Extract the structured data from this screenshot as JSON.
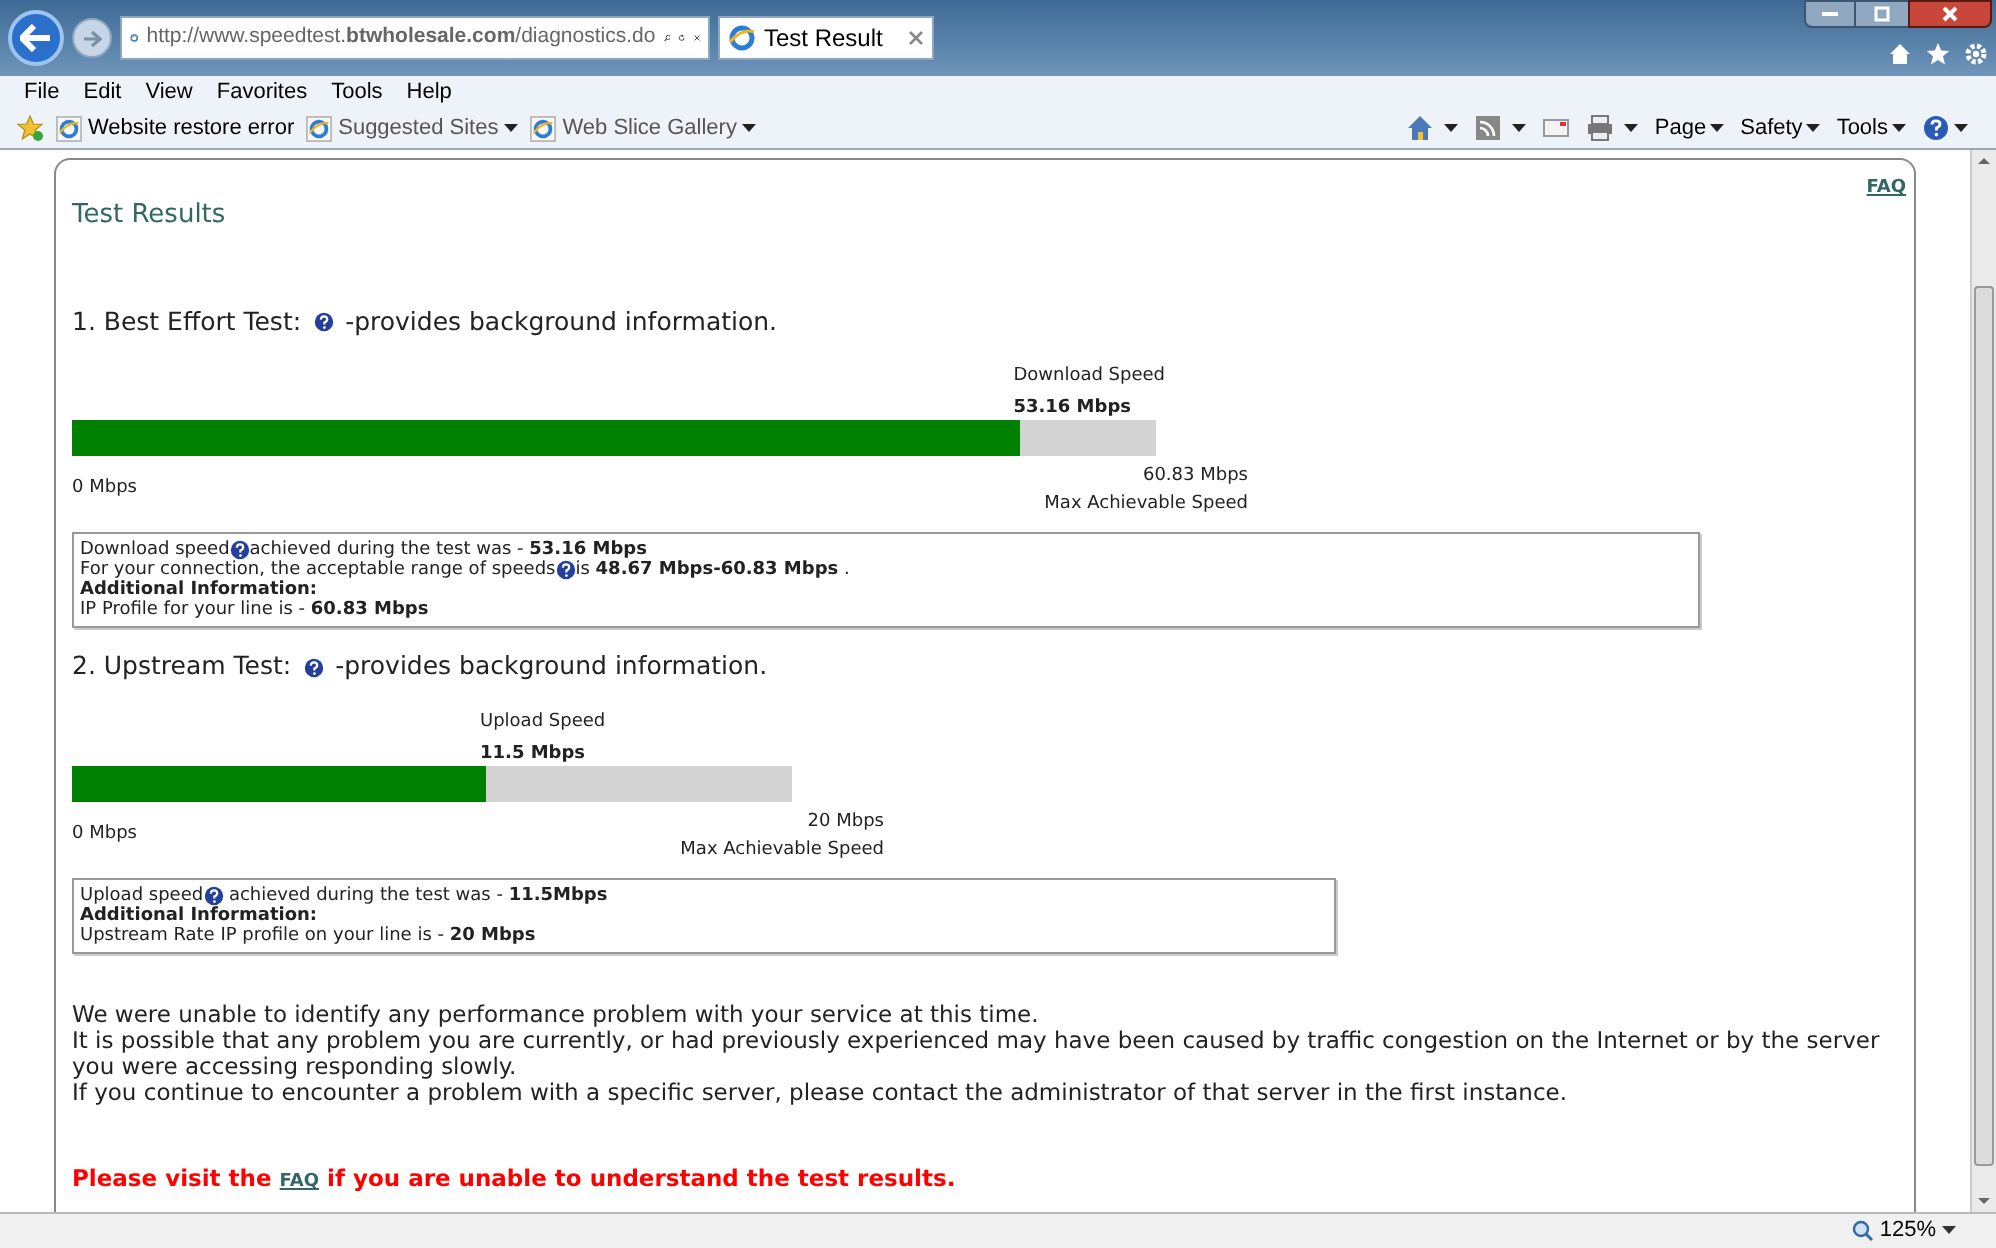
{
  "browser": {
    "address": "http://www.speedtest.**btwholesale.com**/diagnostics.do",
    "tab": {
      "title": "Test Result",
      "selected": true
    },
    "menu": [
      "File",
      "Edit",
      "View",
      "Favorites",
      "Tools",
      "Help"
    ],
    "favorites": [
      {
        "label": "Website restore error",
        "dropdown": false
      },
      {
        "label": "Suggested Sites",
        "dropdown": true
      },
      {
        "label": "Web Slice Gallery",
        "dropdown": true
      }
    ],
    "commands": [
      "Page",
      "Safety",
      "Tools"
    ],
    "zoom": "125%"
  },
  "page": {
    "title": "Test Results",
    "faq_link": "FAQ",
    "tests": [
      {
        "heading": "1. Best Effort Test:",
        "heading_note": "-provides background information.",
        "speed_label": "Download Speed",
        "speed_value": "53.16 Mbps",
        "level": 0.874,
        "min_label": "0 Mbps",
        "max_value": "60.83 Mbps",
        "max_label": "Max Achievable Speed",
        "lines": [
          {
            "lead": "Download speed",
            "rest": "achieved during the test was - **53.16 Mbps**"
          },
          {
            "lead": "For your connection, the acceptable range of speeds",
            "rest": "is **48.67 Mbps-60.83 Mbps** ."
          },
          {
            "text": "Additional Information:",
            "bold": true
          },
          {
            "text": "IP Profile for your line is - **60.83 Mbps**",
            "bold": false
          }
        ]
      },
      {
        "heading": "2. Upstream Test:",
        "heading_note": "-provides background information.",
        "speed_label": "Upload Speed",
        "speed_value": "11.5 Mbps",
        "level": 0.575,
        "min_label": "0 Mbps",
        "max_value": "20 Mbps",
        "max_label": "Max Achievable Speed",
        "lines": [
          {
            "lead": "Upload speed",
            "rest": " achieved during the test was - **11.5Mbps**"
          },
          {
            "text": "Additional Information:",
            "bold": true
          },
          {
            "text": "Upstream Rate IP profile on your line is - **20 Mbps**",
            "bold": false
          }
        ]
      }
    ],
    "summary": [
      "We were unable to identify any performance problem with your service at this time.",
      "It is possible that any problem you are currently, or had previously experienced may have been caused by traffic congestion on the Internet or by the server you were accessing responding slowly.",
      "If you continue to encounter a problem with a specific server, please contact the administrator of that server in the first instance."
    ],
    "notice": {
      "before": "Please visit the",
      "link": "FAQ",
      "after": "if you are unable to understand the test results."
    }
  }
}
